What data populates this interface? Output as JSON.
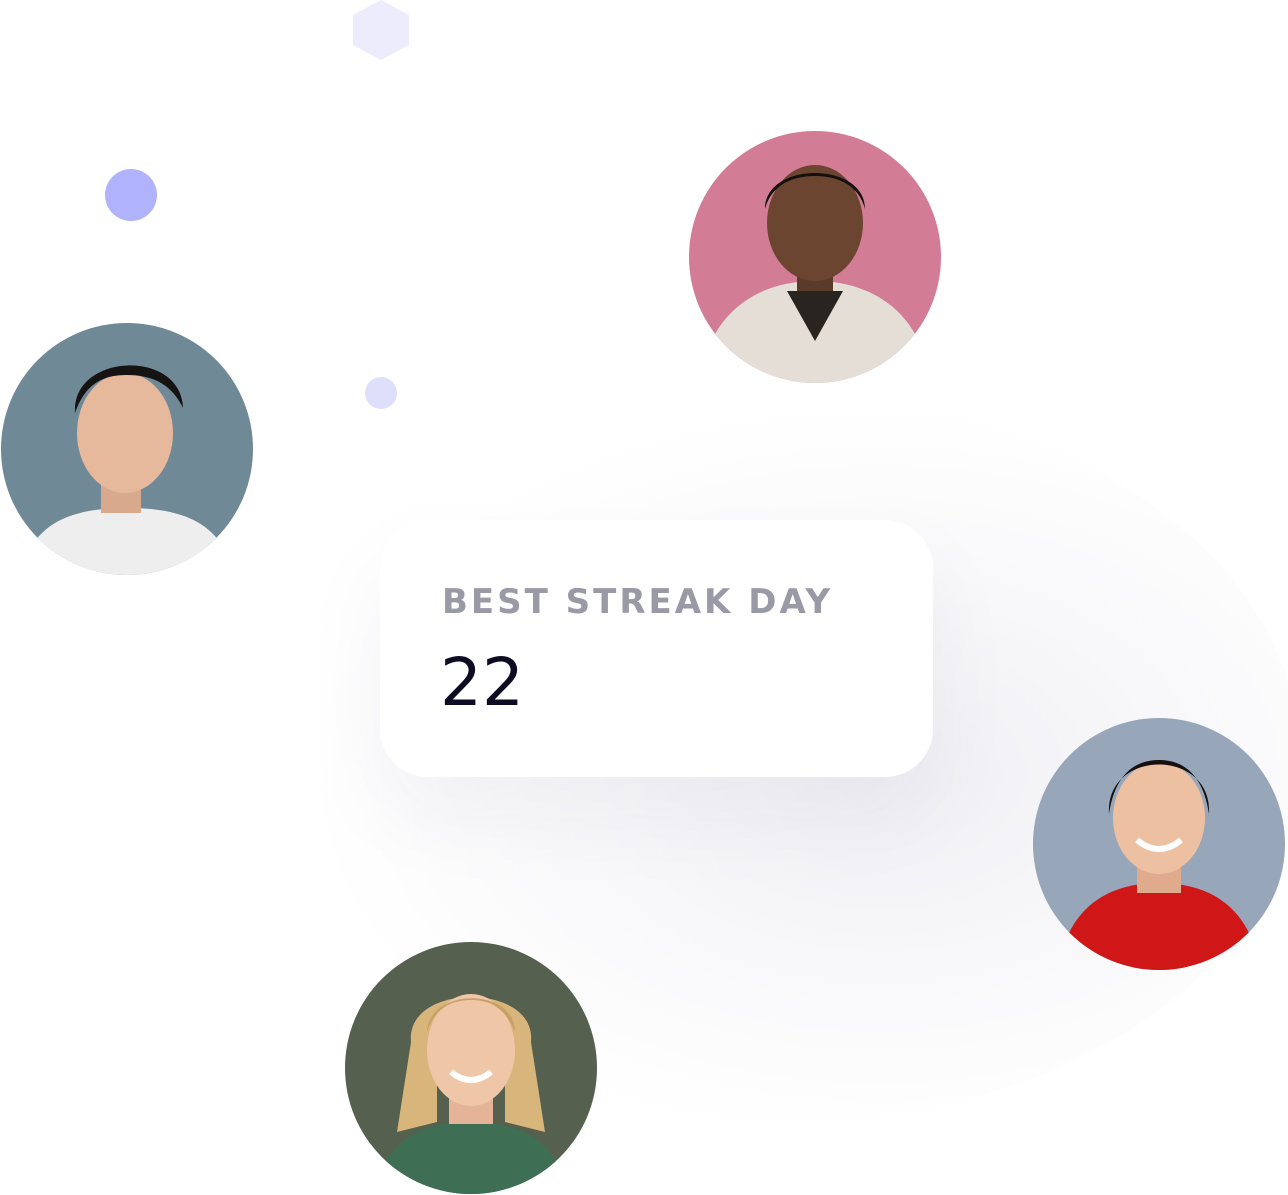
{
  "stat": {
    "label": "BEST STREAK DAY",
    "value": "22"
  },
  "colors": {
    "accent_dot": "#b0b2fb",
    "light_dot": "#dedffb",
    "hexagon": "#ececfd",
    "label_text": "#9a99a6",
    "value_text": "#0e0c22"
  },
  "avatars": [
    {
      "icon": "person-photo-icon",
      "background": "#d27c95",
      "shirt": "#e4ded6"
    },
    {
      "icon": "person-photo-icon",
      "background": "#6f8a96",
      "shirt": "#eeeeee"
    },
    {
      "icon": "person-photo-icon",
      "background": "#97a6b9",
      "shirt": "#d01717"
    },
    {
      "icon": "person-photo-icon",
      "background": "#56604f",
      "shirt": "#3e6f54"
    }
  ]
}
